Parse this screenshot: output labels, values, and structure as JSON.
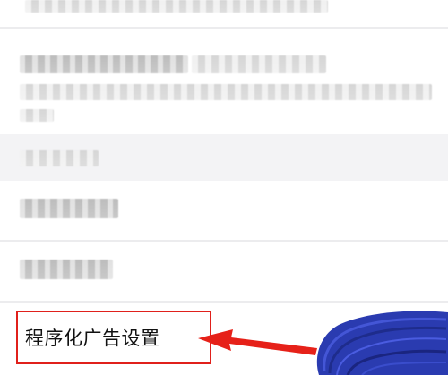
{
  "settings_list": {
    "highlighted_item": {
      "label": "程序化广告设置"
    }
  },
  "colors": {
    "highlight_border": "#e0201b",
    "arrow": "#e62119",
    "pointer": "#2a3bb0",
    "section_gray": "#f3f3f5"
  },
  "icons": {
    "pointer": "hand-pointer-icon",
    "arrow": "red-arrow-icon"
  }
}
